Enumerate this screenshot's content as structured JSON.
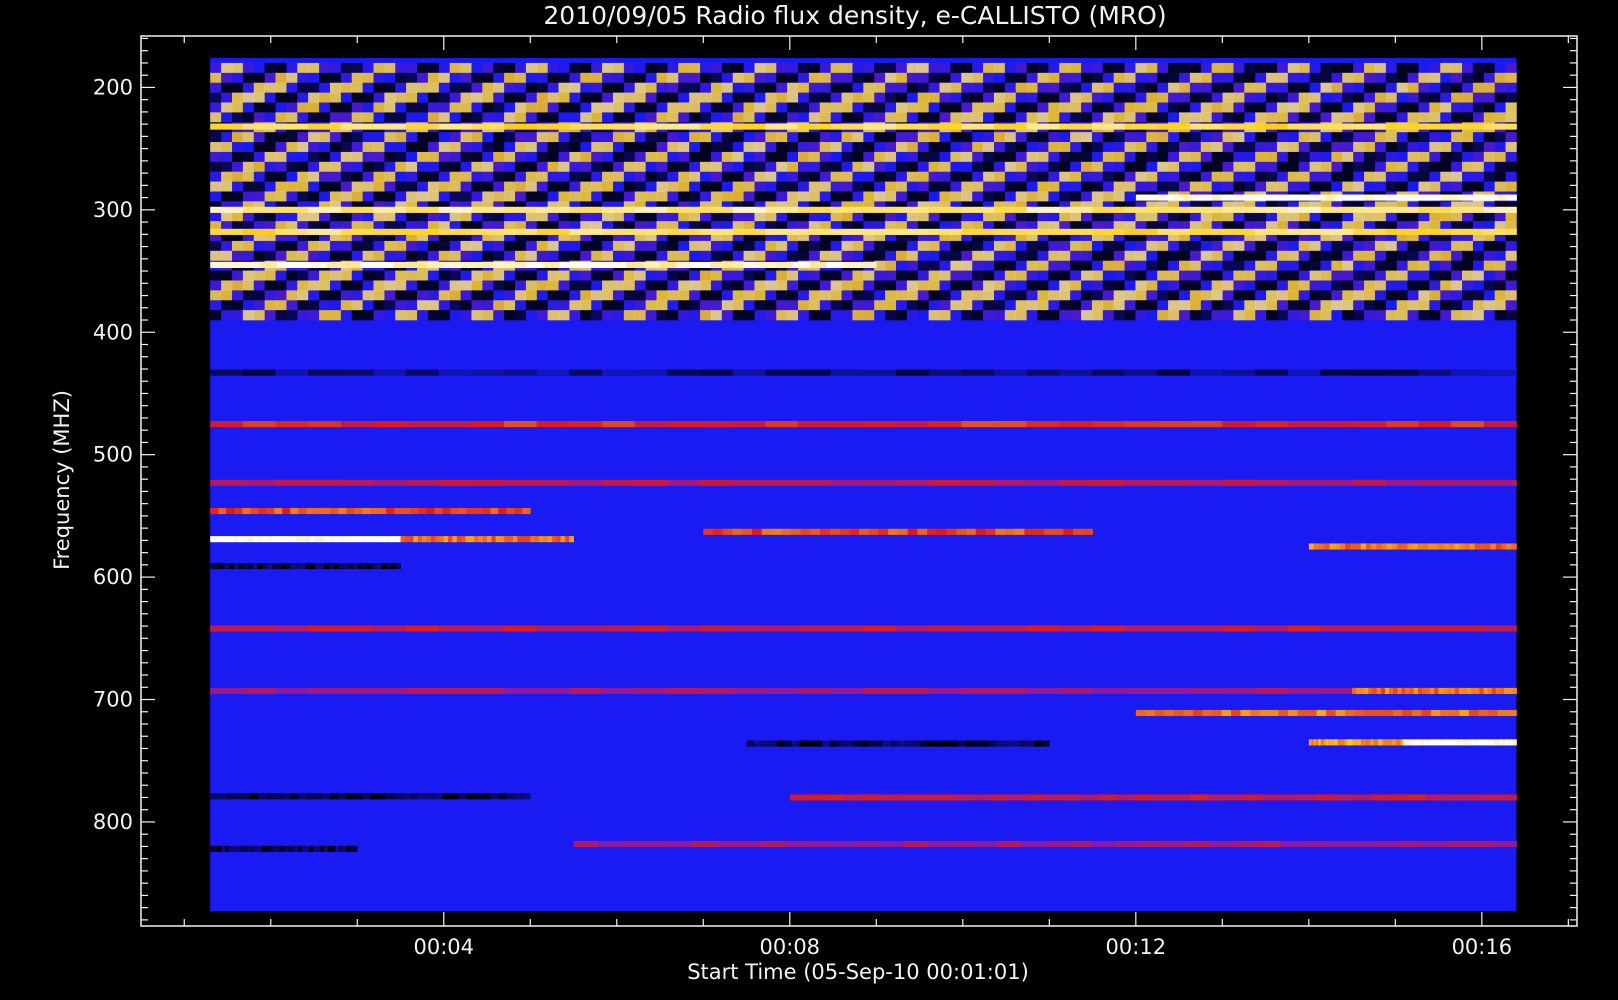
{
  "chart_data": {
    "type": "heatmap",
    "title": "2010/09/05  Radio flux density, e-CALLISTO (MRO)",
    "xlabel": "Start Time (05-Sep-10 00:01:01)",
    "ylabel": "Frequency (MHZ)",
    "x_ticks": [
      "00:04",
      "00:08",
      "00:12",
      "00:16"
    ],
    "y_ticks": [
      "200",
      "300",
      "400",
      "500",
      "600",
      "700",
      "800"
    ],
    "x_range_minutes": [
      0.5,
      17.1
    ],
    "data_x_range_minutes": [
      1.3,
      16.4
    ],
    "y_range_mhz": [
      158,
      885
    ],
    "data_y_range_mhz": [
      176,
      873
    ],
    "y_axis_inverted": true,
    "colormap": [
      "#000000",
      "#1a1af2",
      "#8a1aa0",
      "#e01818",
      "#ffd21a",
      "#ffffff"
    ],
    "background_color": "#1a1af2",
    "features": [
      {
        "kind": "interference",
        "freq_range_mhz": [
          180,
          390
        ],
        "x_range_minutes": [
          1.3,
          16.4
        ],
        "intensity": 0.75
      },
      {
        "kind": "band",
        "freq_mhz": 232,
        "x_range_minutes": [
          1.3,
          16.4
        ],
        "intensity": 0.85
      },
      {
        "kind": "band",
        "freq_mhz": 300,
        "x_range_minutes": [
          1.3,
          16.4
        ],
        "intensity": 0.9
      },
      {
        "kind": "band",
        "freq_mhz": 318,
        "x_range_minutes": [
          1.3,
          16.4
        ],
        "intensity": 0.85
      },
      {
        "kind": "band",
        "freq_mhz": 345,
        "x_range_minutes": [
          1.3,
          9.0
        ],
        "intensity": 0.95
      },
      {
        "kind": "band",
        "freq_mhz": 290,
        "x_range_minutes": [
          12.0,
          16.4
        ],
        "intensity": 1.0
      },
      {
        "kind": "band",
        "freq_mhz": 433,
        "x_range_minutes": [
          1.3,
          16.4
        ],
        "intensity": 0.1
      },
      {
        "kind": "band",
        "freq_mhz": 475,
        "x_range_minutes": [
          1.3,
          16.4
        ],
        "intensity": 0.6
      },
      {
        "kind": "band",
        "freq_mhz": 523,
        "x_range_minutes": [
          1.3,
          16.4
        ],
        "intensity": 0.5
      },
      {
        "kind": "band",
        "freq_mhz": 546,
        "x_range_minutes": [
          1.3,
          5.0
        ],
        "intensity": 0.65
      },
      {
        "kind": "band",
        "freq_mhz": 569,
        "x_range_minutes": [
          1.3,
          3.5
        ],
        "intensity": 1.0
      },
      {
        "kind": "band",
        "freq_mhz": 569,
        "x_range_minutes": [
          3.5,
          5.5
        ],
        "intensity": 0.7
      },
      {
        "kind": "band",
        "freq_mhz": 563,
        "x_range_minutes": [
          7.0,
          11.5
        ],
        "intensity": 0.65
      },
      {
        "kind": "band",
        "freq_mhz": 575,
        "x_range_minutes": [
          14.0,
          16.4
        ],
        "intensity": 0.7
      },
      {
        "kind": "band",
        "freq_mhz": 591,
        "x_range_minutes": [
          1.3,
          3.5
        ],
        "intensity": 0.05
      },
      {
        "kind": "band",
        "freq_mhz": 642,
        "x_range_minutes": [
          1.3,
          16.4
        ],
        "intensity": 0.55
      },
      {
        "kind": "band",
        "freq_mhz": 693,
        "x_range_minutes": [
          1.3,
          16.4
        ],
        "intensity": 0.45
      },
      {
        "kind": "band",
        "freq_mhz": 693,
        "x_range_minutes": [
          14.5,
          16.4
        ],
        "intensity": 0.7
      },
      {
        "kind": "band",
        "freq_mhz": 711,
        "x_range_minutes": [
          12.0,
          16.4
        ],
        "intensity": 0.7
      },
      {
        "kind": "band",
        "freq_mhz": 735,
        "x_range_minutes": [
          14.0,
          15.1
        ],
        "intensity": 0.75
      },
      {
        "kind": "band",
        "freq_mhz": 735,
        "x_range_minutes": [
          15.1,
          16.4
        ],
        "intensity": 1.0
      },
      {
        "kind": "band",
        "freq_mhz": 736,
        "x_range_minutes": [
          7.5,
          11.0
        ],
        "intensity": 0.05
      },
      {
        "kind": "band",
        "freq_mhz": 779,
        "x_range_minutes": [
          1.3,
          5.0
        ],
        "intensity": 0.05
      },
      {
        "kind": "band",
        "freq_mhz": 780,
        "x_range_minutes": [
          8.0,
          16.4
        ],
        "intensity": 0.55
      },
      {
        "kind": "band",
        "freq_mhz": 822,
        "x_range_minutes": [
          1.3,
          3.0
        ],
        "intensity": 0.05
      },
      {
        "kind": "band",
        "freq_mhz": 818,
        "x_range_minutes": [
          5.5,
          16.4
        ],
        "intensity": 0.45
      }
    ]
  }
}
